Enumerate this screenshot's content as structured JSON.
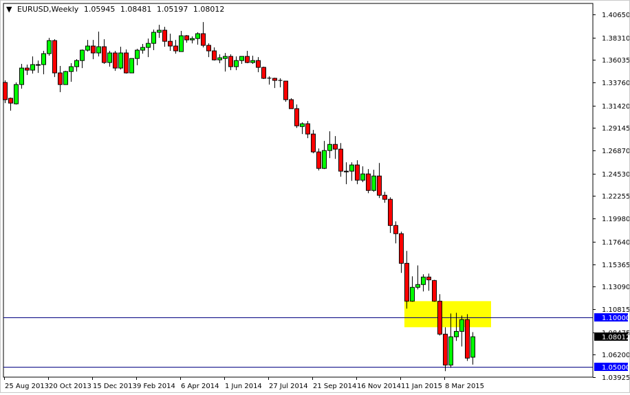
{
  "header": {
    "symbol": "EURUSD,Weekly",
    "open": "1.05945",
    "high": "1.08481",
    "low": "1.05197",
    "close": "1.08012"
  },
  "colors": {
    "bull": "#00ff00",
    "bear": "#ff0000",
    "zone": "#ffff00",
    "line": "#000080",
    "line_label_bg": "#0000ff",
    "price_label_bg": "#000000"
  },
  "chart_data": {
    "type": "candlestick",
    "title": "EURUSD,Weekly",
    "ylim": [
      1.03925,
      1.4065
    ],
    "y_ticks": [
      "1.40650",
      "1.38310",
      "1.36035",
      "1.33760",
      "1.31420",
      "1.29145",
      "1.26870",
      "1.24530",
      "1.22255",
      "1.19980",
      "1.17640",
      "1.15365",
      "1.13090",
      "1.10815",
      "1.08475",
      "1.06200",
      "1.03925"
    ],
    "x_labels": [
      {
        "label": "25 Aug 2013",
        "index": 0
      },
      {
        "label": "20 Oct 2013",
        "index": 8
      },
      {
        "label": "15 Dec 2013",
        "index": 16
      },
      {
        "label": "9 Feb 2014",
        "index": 24
      },
      {
        "label": "6 Apr 2014",
        "index": 32
      },
      {
        "label": "1 Jun 2014",
        "index": 40
      },
      {
        "label": "27 Jul 2014",
        "index": 48
      },
      {
        "label": "21 Sep 2014",
        "index": 56
      },
      {
        "label": "16 Nov 2014",
        "index": 64
      },
      {
        "label": "11 Jan 2015",
        "index": 72
      },
      {
        "label": "8 Mar 2015",
        "index": 80
      }
    ],
    "ohlc_fields": [
      "open",
      "high",
      "low",
      "close"
    ],
    "candles": [
      [
        1.3376,
        1.3397,
        1.3167,
        1.3202
      ],
      [
        1.3216,
        1.3223,
        1.309,
        1.3167
      ],
      [
        1.316,
        1.3376,
        1.3153,
        1.3355
      ],
      [
        1.3355,
        1.3564,
        1.3313,
        1.3522
      ],
      [
        1.3522,
        1.3557,
        1.3452,
        1.3501
      ],
      [
        1.3501,
        1.364,
        1.3466,
        1.3557
      ],
      [
        1.3557,
        1.3598,
        1.3473,
        1.355
      ],
      [
        1.3557,
        1.3696,
        1.3459,
        1.3668
      ],
      [
        1.3668,
        1.3828,
        1.3647,
        1.38
      ],
      [
        1.38,
        1.3814,
        1.3431,
        1.3473
      ],
      [
        1.3473,
        1.3543,
        1.3278,
        1.3355
      ],
      [
        1.3355,
        1.3494,
        1.3355,
        1.3487
      ],
      [
        1.3487,
        1.3571,
        1.3383,
        1.3536
      ],
      [
        1.3536,
        1.3612,
        1.3487,
        1.3598
      ],
      [
        1.3598,
        1.371,
        1.3522,
        1.3703
      ],
      [
        1.3703,
        1.3807,
        1.3689,
        1.3745
      ],
      [
        1.3745,
        1.3807,
        1.3612,
        1.3675
      ],
      [
        1.3675,
        1.3891,
        1.364,
        1.3738
      ],
      [
        1.3738,
        1.3814,
        1.3564,
        1.3578
      ],
      [
        1.3578,
        1.3696,
        1.3536,
        1.3675
      ],
      [
        1.3675,
        1.3696,
        1.3494,
        1.3522
      ],
      [
        1.3522,
        1.3738,
        1.3508,
        1.3675
      ],
      [
        1.3675,
        1.371,
        1.3466,
        1.3473
      ],
      [
        1.3473,
        1.3619,
        1.3473,
        1.3619
      ],
      [
        1.3619,
        1.3717,
        1.355,
        1.3703
      ],
      [
        1.3703,
        1.3766,
        1.3668,
        1.3731
      ],
      [
        1.3731,
        1.3821,
        1.3633,
        1.3772
      ],
      [
        1.3772,
        1.3912,
        1.3703,
        1.3884
      ],
      [
        1.3884,
        1.396,
        1.3828,
        1.3905
      ],
      [
        1.3905,
        1.394,
        1.3738,
        1.3793
      ],
      [
        1.3793,
        1.387,
        1.3696,
        1.3745
      ],
      [
        1.3745,
        1.3807,
        1.3668,
        1.3696
      ],
      [
        1.3689,
        1.3898,
        1.3689,
        1.3849
      ],
      [
        1.3849,
        1.3856,
        1.3779,
        1.3807
      ],
      [
        1.3807,
        1.3842,
        1.3772,
        1.3821
      ],
      [
        1.3821,
        1.3884,
        1.3759,
        1.387
      ],
      [
        1.387,
        1.3988,
        1.3731,
        1.3752
      ],
      [
        1.3752,
        1.3772,
        1.3633,
        1.3696
      ],
      [
        1.3696,
        1.3731,
        1.3598,
        1.3605
      ],
      [
        1.3605,
        1.3661,
        1.3571,
        1.3626
      ],
      [
        1.3619,
        1.3675,
        1.3487,
        1.364
      ],
      [
        1.364,
        1.3661,
        1.3501,
        1.3536
      ],
      [
        1.3536,
        1.364,
        1.3501,
        1.3598
      ],
      [
        1.3598,
        1.364,
        1.3564,
        1.364
      ],
      [
        1.364,
        1.3696,
        1.3571,
        1.3578
      ],
      [
        1.3578,
        1.3647,
        1.3564,
        1.3598
      ],
      [
        1.3598,
        1.3633,
        1.348,
        1.3529
      ],
      [
        1.3529,
        1.3536,
        1.3411,
        1.3418
      ],
      [
        1.3418,
        1.3438,
        1.3355,
        1.342
      ],
      [
        1.3418,
        1.3424,
        1.332,
        1.3397
      ],
      [
        1.3397,
        1.3418,
        1.3327,
        1.3395
      ],
      [
        1.339,
        1.339,
        1.3181,
        1.3202
      ],
      [
        1.3202,
        1.3216,
        1.3111,
        1.3111
      ],
      [
        1.3111,
        1.3153,
        1.2916,
        1.2937
      ],
      [
        1.293,
        1.2972,
        1.2854,
        1.2958
      ],
      [
        1.2958,
        1.2986,
        1.2812,
        1.2854
      ],
      [
        1.2854,
        1.2896,
        1.2659,
        1.2673
      ],
      [
        1.2673,
        1.2708,
        1.2485,
        1.2506
      ],
      [
        1.2506,
        1.2784,
        1.2499,
        1.2687
      ],
      [
        1.2687,
        1.2882,
        1.261,
        1.2749
      ],
      [
        1.2749,
        1.2833,
        1.2603,
        1.2701
      ],
      [
        1.2701,
        1.2763,
        1.2422,
        1.2478
      ],
      [
        1.2478,
        1.2568,
        1.2346,
        1.2471
      ],
      [
        1.2478,
        1.2568,
        1.238,
        1.2541
      ],
      [
        1.2541,
        1.2589,
        1.2346,
        1.2387
      ],
      [
        1.2387,
        1.2527,
        1.2367,
        1.245
      ],
      [
        1.245,
        1.2499,
        1.2255,
        1.2283
      ],
      [
        1.2283,
        1.2492,
        1.2269,
        1.2429
      ],
      [
        1.2429,
        1.2561,
        1.2206,
        1.2234
      ],
      [
        1.2234,
        1.2269,
        1.2158,
        1.2193
      ],
      [
        1.2193,
        1.2213,
        1.1852,
        1.1928
      ],
      [
        1.1928,
        1.197,
        1.1747,
        1.1845
      ],
      [
        1.1845,
        1.1865,
        1.1448,
        1.1545
      ],
      [
        1.1545,
        1.1671,
        1.1086,
        1.1162
      ],
      [
        1.1162,
        1.1413,
        1.1156,
        1.1302
      ],
      [
        1.1302,
        1.1524,
        1.1281,
        1.133
      ],
      [
        1.133,
        1.1434,
        1.126,
        1.1406
      ],
      [
        1.1406,
        1.1441,
        1.1267,
        1.1378
      ],
      [
        1.1371,
        1.1378,
        1.1156,
        1.1162
      ],
      [
        1.1162,
        1.1232,
        1.0814,
        1.0828
      ],
      [
        1.0828,
        1.0898,
        1.0453,
        1.0515
      ],
      [
        1.0515,
        1.1037,
        1.0487,
        1.0801
      ],
      [
        1.0801,
        1.1044,
        1.0759,
        1.0856
      ],
      [
        1.0856,
        1.1016,
        1.0703,
        1.0975
      ],
      [
        1.0975,
        1.103,
        1.0557,
        1.0585
      ],
      [
        1.05945,
        1.08481,
        1.05197,
        1.08012
      ]
    ],
    "zone": {
      "top": 1.1162,
      "bottom": 1.0898,
      "from_index": 73,
      "to_index": 88
    },
    "hlines": [
      {
        "value": 1.1,
        "label": "1.10000"
      },
      {
        "value": 1.05,
        "label": "1.05000"
      }
    ],
    "current_price": {
      "value": 1.08012,
      "label": "1.08012"
    }
  }
}
